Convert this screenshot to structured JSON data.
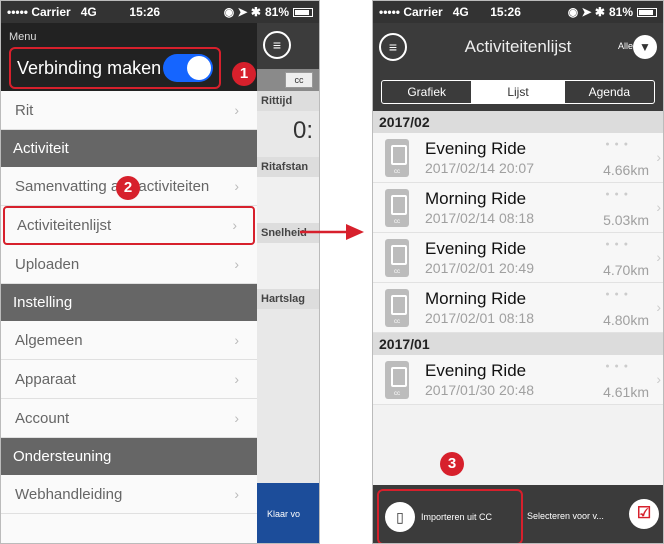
{
  "left_screen": {
    "status": {
      "carrier": "••••• Carrier",
      "network": "4G",
      "time": "15:26",
      "battery": "81%"
    },
    "menu": {
      "title": "Menu",
      "connect_label": "Verbinding maken",
      "connect_on": true,
      "items": [
        {
          "type": "item",
          "label": "Rit"
        },
        {
          "type": "section",
          "label": "Activiteit"
        },
        {
          "type": "item",
          "label": "Samenvatting alle activiteiten"
        },
        {
          "type": "item",
          "label": "Activiteitenlijst"
        },
        {
          "type": "item",
          "label": "Uploaden"
        },
        {
          "type": "section",
          "label": "Instelling"
        },
        {
          "type": "item",
          "label": "Algemeen"
        },
        {
          "type": "item",
          "label": "Apparaat"
        },
        {
          "type": "item",
          "label": "Account"
        },
        {
          "type": "section",
          "label": "Ondersteuning"
        },
        {
          "type": "item",
          "label": "Webhandleiding"
        }
      ]
    },
    "under": {
      "cc_chip": "cc",
      "labels": [
        "Rittijd",
        "Ritafstan",
        "Snelheid",
        "Hartslag"
      ],
      "big_value": "0:",
      "blue_label": "Klaar vo"
    }
  },
  "right_screen": {
    "status": {
      "carrier": "••••• Carrier",
      "network": "4G",
      "time": "15:26",
      "battery": "81%"
    },
    "title": "Activiteitenlijst",
    "filter_label": "Alle",
    "tabs": [
      "Grafiek",
      "Lijst",
      "Agenda"
    ],
    "active_tab": "Lijst",
    "groups": [
      {
        "month": "2017/02",
        "rides": [
          {
            "name": "Evening Ride",
            "date": "2017/02/14 20:07",
            "distance": "4.66km"
          },
          {
            "name": "Morning Ride",
            "date": "2017/02/14 08:18",
            "distance": "5.03km"
          },
          {
            "name": "Evening Ride",
            "date": "2017/02/01 20:49",
            "distance": "4.70km"
          },
          {
            "name": "Morning Ride",
            "date": "2017/02/01 08:18",
            "distance": "4.80km"
          }
        ]
      },
      {
        "month": "2017/01",
        "rides": [
          {
            "name": "Evening Ride",
            "date": "2017/01/30 20:48",
            "distance": "4.61km"
          }
        ]
      }
    ],
    "bottom": {
      "import_label": "Importeren uit CC",
      "select_label": "Selecteren voor v..."
    }
  },
  "badges": [
    "1",
    "2",
    "3"
  ],
  "colors": {
    "highlight": "#d7202c",
    "toggle": "#1565ff",
    "nav": "#3b3b3b"
  }
}
